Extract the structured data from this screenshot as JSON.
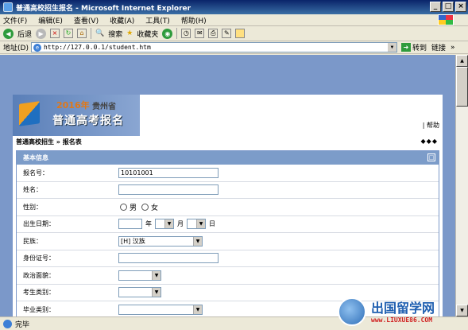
{
  "window": {
    "title": "普通高校招生报名 - Microsoft Internet Explorer",
    "minimize": "_",
    "maximize": "□",
    "close": "×"
  },
  "menu": [
    "文件(F)",
    "编辑(E)",
    "查看(V)",
    "收藏(A)",
    "工具(T)",
    "帮助(H)"
  ],
  "toolbar": {
    "back": "后退",
    "search": "搜索",
    "favorites": "收藏夹"
  },
  "address": {
    "label": "地址(D)",
    "url": "http://127.0.0.1/student.htm",
    "go": "转到",
    "links": "链接"
  },
  "banner": {
    "year": "2016年",
    "province": "贵州省",
    "title": "普通高考报名",
    "help": "| 帮助"
  },
  "breadcrumb": "普通高校招生 » 报名表",
  "dots": "◆◆◆",
  "form": {
    "section_title": "基本信息",
    "collapse_icon": "□",
    "fields": {
      "reg_no_label": "报名号：",
      "reg_no_value": "10101001",
      "name_label": "姓名：",
      "gender_label": "性别：",
      "gender_male": "男",
      "gender_female": "女",
      "birth_label": "出生日期：",
      "year_unit": "年",
      "month_unit": "月",
      "day_unit": "日",
      "ethnicity_label": "民族：",
      "ethnicity_value": "[H] 汉族",
      "id_label": "身份证号：",
      "politics_label": "政治面貌：",
      "category_label": "考生类别：",
      "grad_label": "毕业类别："
    }
  },
  "status": "完毕",
  "watermark": {
    "title": "出国留学网",
    "url": "www.LIUXUE86.COM"
  }
}
